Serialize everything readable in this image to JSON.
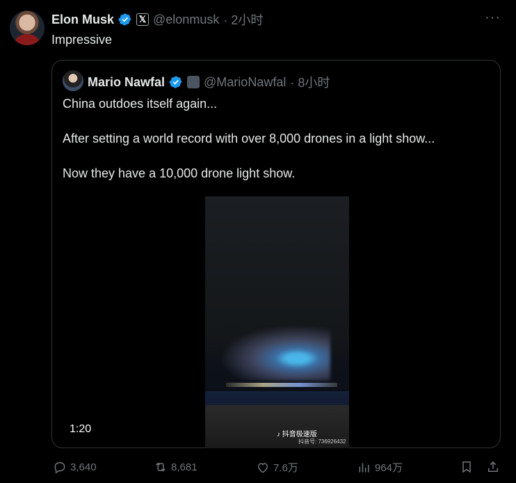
{
  "tweet": {
    "author_name": "Elon Musk",
    "handle": "@elonmusk",
    "time": "· 2小时",
    "text": "Impressive",
    "more_label": "···",
    "x_badge": "𝕏"
  },
  "quote": {
    "author_name": "Mario Nawfal",
    "handle": "@MarioNawfal",
    "time": "· 8小时",
    "lines": [
      "China outdoes itself again...",
      "After setting a world record with over 8,000 drones in a light show...",
      "Now they have a 10,000 drone light show."
    ],
    "video": {
      "duration": "1:20",
      "watermark": "抖音极速版",
      "douyin_id": "抖音号: 736926432"
    }
  },
  "actions": {
    "reply_count": "3,640",
    "retweet_count": "8,681",
    "like_count": "7.6万",
    "views_count": "964万"
  },
  "colors": {
    "verified": "#1d9bf0",
    "muted": "#71767b",
    "text": "#e7e9ea",
    "border": "#2f3336"
  }
}
